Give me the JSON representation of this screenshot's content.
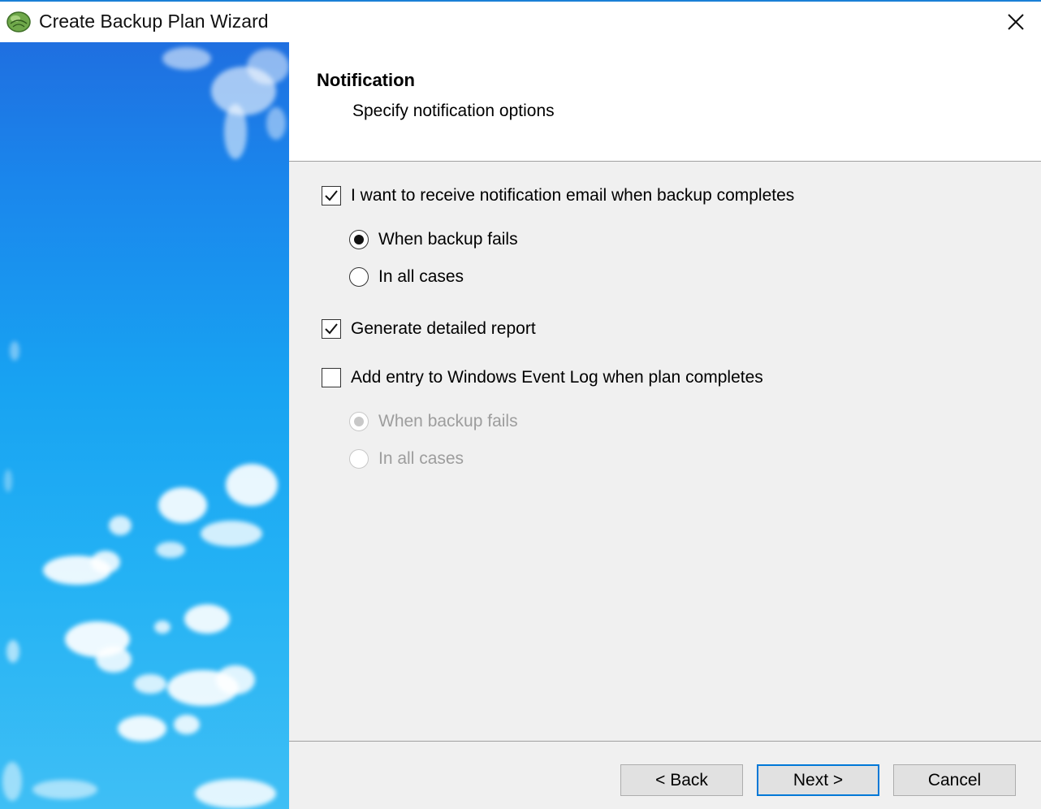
{
  "window": {
    "title": "Create Backup Plan Wizard",
    "accent_color": "#0078d7"
  },
  "header": {
    "title": "Notification",
    "subtitle": "Specify notification options"
  },
  "options": {
    "email_notify": {
      "label": "I want to receive notification email when backup completes",
      "checked": true,
      "choices": [
        {
          "label": "When backup fails",
          "selected": true
        },
        {
          "label": "In all cases",
          "selected": false
        }
      ]
    },
    "detailed_report": {
      "label": "Generate detailed report",
      "checked": true
    },
    "event_log": {
      "label": "Add entry to Windows Event Log when plan completes",
      "checked": false,
      "choices": [
        {
          "label": "When backup fails",
          "selected": true
        },
        {
          "label": "In all cases",
          "selected": false
        }
      ]
    }
  },
  "footer": {
    "back_label": "< Back",
    "next_label": "Next >",
    "cancel_label": "Cancel"
  }
}
